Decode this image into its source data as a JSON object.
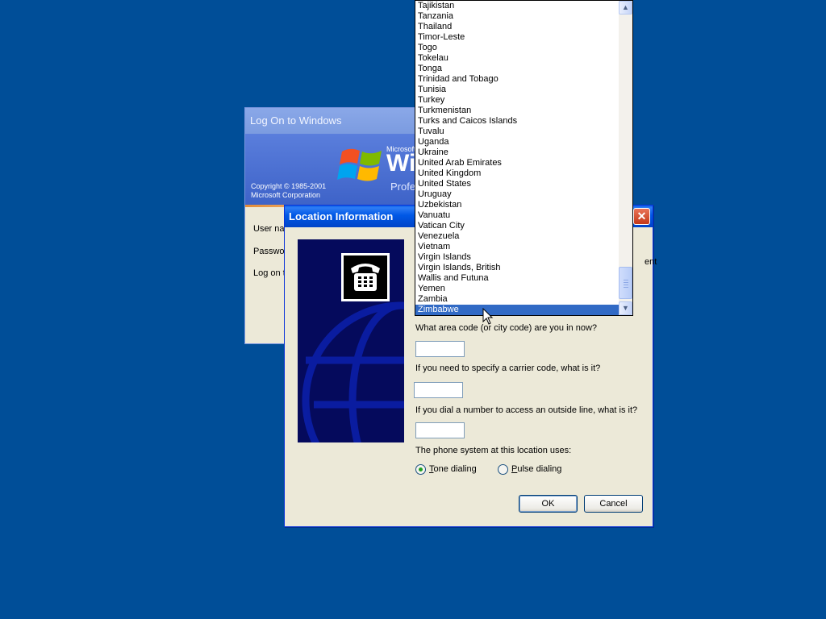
{
  "logon": {
    "title": "Log On to Windows",
    "brand_small": "Microsoft",
    "brand_big": "Wi",
    "brand_edition": "Profe",
    "copyright_line1": "Copyright © 1985-2001",
    "copyright_line2": "Microsoft Corporation",
    "user_label": "User na",
    "password_label": "Passwo",
    "logon_label": "Log on t"
  },
  "location_dialog": {
    "title": "Location Information",
    "close_glyph": "✕",
    "hidden_text_fragment": "ent",
    "area_code_question": "What area code (or city code) are you in now?",
    "area_code_value": "",
    "carrier_question": "If you need to specify a carrier code, what is it?",
    "carrier_value": "",
    "outside_line_question": "If you dial a number to access an outside line, what is it?",
    "outside_line_value": "",
    "phone_system_label": "The phone system at this location uses:",
    "tone_prefix": "",
    "tone_key": "T",
    "tone_rest": "one dialing",
    "tone_checked": true,
    "pulse_prefix": "",
    "pulse_key": "P",
    "pulse_rest": "ulse dialing",
    "pulse_checked": false,
    "ok_label": "OK",
    "cancel_label": "Cancel"
  },
  "country_list": {
    "items": [
      "Tajikistan",
      "Tanzania",
      "Thailand",
      "Timor-Leste",
      "Togo",
      "Tokelau",
      "Tonga",
      "Trinidad and Tobago",
      "Tunisia",
      "Turkey",
      "Turkmenistan",
      "Turks and Caicos Islands",
      "Tuvalu",
      "Uganda",
      "Ukraine",
      "United Arab Emirates",
      "United Kingdom",
      "United States",
      "Uruguay",
      "Uzbekistan",
      "Vanuatu",
      "Vatican City",
      "Venezuela",
      "Vietnam",
      "Virgin Islands",
      "Virgin Islands, British",
      "Wallis and Futuna",
      "Yemen",
      "Zambia",
      "Zimbabwe"
    ],
    "selected": "Zimbabwe",
    "scroll_up_glyph": "▲",
    "scroll_down_glyph": "▼"
  },
  "colors": {
    "desktop": "#004E98",
    "titlebar_blue": "#0058E6",
    "selection": "#316AC5",
    "dialog_face": "#ECE9D8"
  }
}
